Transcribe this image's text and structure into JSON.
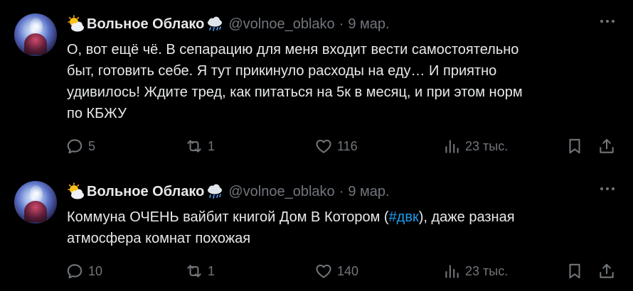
{
  "tweets": [
    {
      "author_name": "Вольное Облако",
      "handle": "@volnoe_oblako",
      "separator": "·",
      "date": "9 мар.",
      "text_lines": [
        "О, вот ещё чё. В сепарацию для меня входит вести самостоятельно",
        "быт, готовить себе. Я тут прикинуло расходы на еду… И приятно",
        "удивилось! Ждите тред, как питаться на 5к в месяц, и при этом норм",
        "по КБЖУ"
      ],
      "replies": "5",
      "retweets": "1",
      "likes": "116",
      "views": "23 тыс."
    },
    {
      "author_name": "Вольное Облако",
      "handle": "@volnoe_oblako",
      "separator": "·",
      "date": "9 мар.",
      "text_line1_before": "Коммуна ОЧЕНЬ вайбит книгой Дом В Котором (",
      "hashtag": "#двк",
      "text_line1_after": "), даже разная",
      "text_line2": "атмосфера комнат похожая",
      "replies": "10",
      "retweets": "1",
      "likes": "140",
      "views": "23 тыс."
    }
  ],
  "icons": {
    "name_prefix": "sun-behind-cloud-icon",
    "name_suffix": "cloud-with-rain-icon",
    "more": "more-icon",
    "reply": "reply-icon",
    "retweet": "retweet-icon",
    "like": "heart-icon",
    "views": "views-icon",
    "bookmark": "bookmark-icon",
    "share": "share-icon"
  },
  "colors": {
    "background": "#000000",
    "text": "#e7e9ea",
    "secondary": "#71767b",
    "link": "#1d9bf0"
  }
}
